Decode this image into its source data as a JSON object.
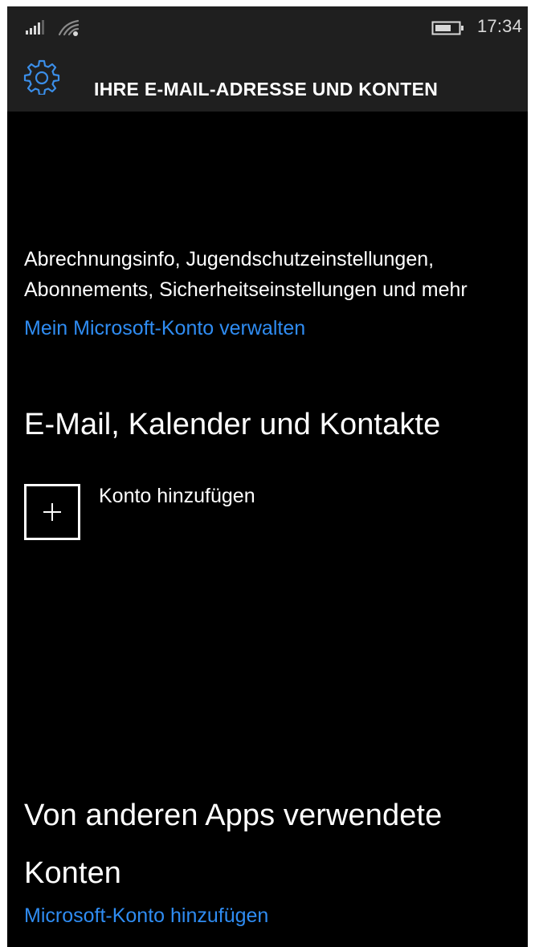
{
  "status_bar": {
    "time": "17:34",
    "signal_icon": "signal-strength-icon",
    "wifi_icon": "wifi-icon",
    "battery_icon": "battery-icon"
  },
  "header": {
    "icon": "gear-icon",
    "title": "IHRE E-MAIL-ADRESSE UND KONTEN"
  },
  "account_summary": {
    "description": "Abrechnungsinfo, Jugendschutzeinstellungen, Abonnements, Sicherheitseinstellungen und mehr",
    "manage_link": "Mein Microsoft-Konto verwalten"
  },
  "email_section": {
    "title": "E-Mail, Kalender und Kontakte",
    "add_account_label": "Konto hinzufügen",
    "add_icon": "plus-icon"
  },
  "other_accounts_section": {
    "title": "Von anderen Apps verwendete Konten",
    "add_microsoft_account_link": "Microsoft-Konto hinzufügen"
  },
  "colors": {
    "background": "#000000",
    "header": "#1f1f1f",
    "accent": "#2f8cf2",
    "text": "#ffffff"
  }
}
